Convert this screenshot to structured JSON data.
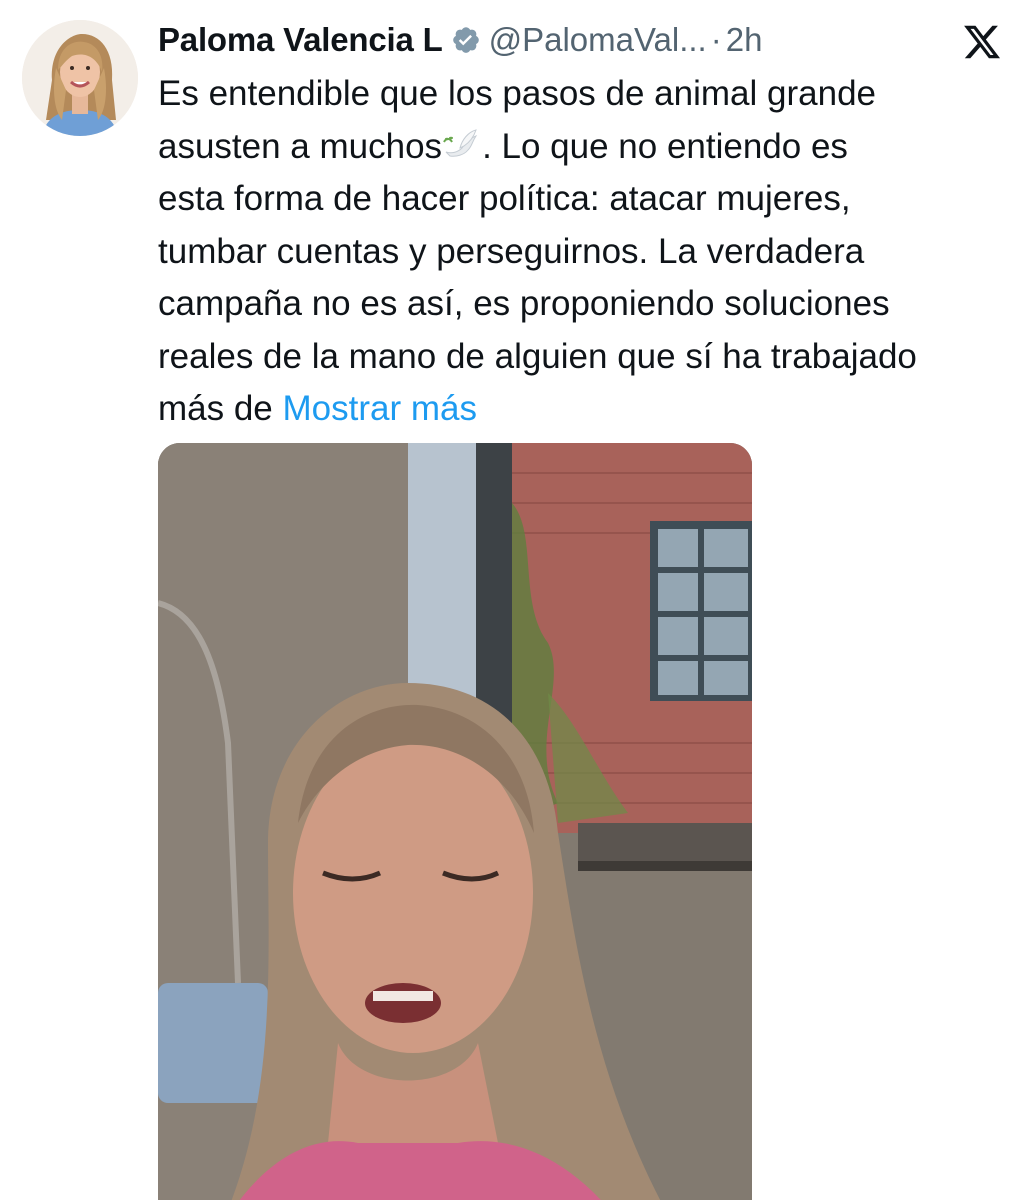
{
  "author": {
    "name": "Paloma Valencia L",
    "handle": "@PalomaVal...",
    "separator": "·",
    "time": "2h",
    "verified_icon": "verified-badge-icon",
    "avatar_icon": "profile-avatar"
  },
  "platform": {
    "logo_icon": "x-logo-icon"
  },
  "tweet": {
    "line1": "Es entendible que los pasos de animal grande",
    "line2_before": "asusten a muchos",
    "line2_emoji_icon": "dove-emoji-icon",
    "line2_after": ". Lo que no entiendo es",
    "line3": "esta forma de hacer política: atacar mujeres,",
    "line4": "tumbar cuentas y perseguirnos. La verdadera",
    "line5": "campaña no es así, es proponiendo soluciones",
    "line6": "reales de la mano de alguien que sí ha trabajado",
    "line7_before": "más de ",
    "show_more": "Mostrar más"
  },
  "media": {
    "type": "video-thumbnail",
    "icon": "video-preview-image"
  },
  "colors": {
    "text": "#0f1419",
    "secondary": "#536471",
    "link": "#1d9bf0",
    "verified": "#829aab"
  }
}
